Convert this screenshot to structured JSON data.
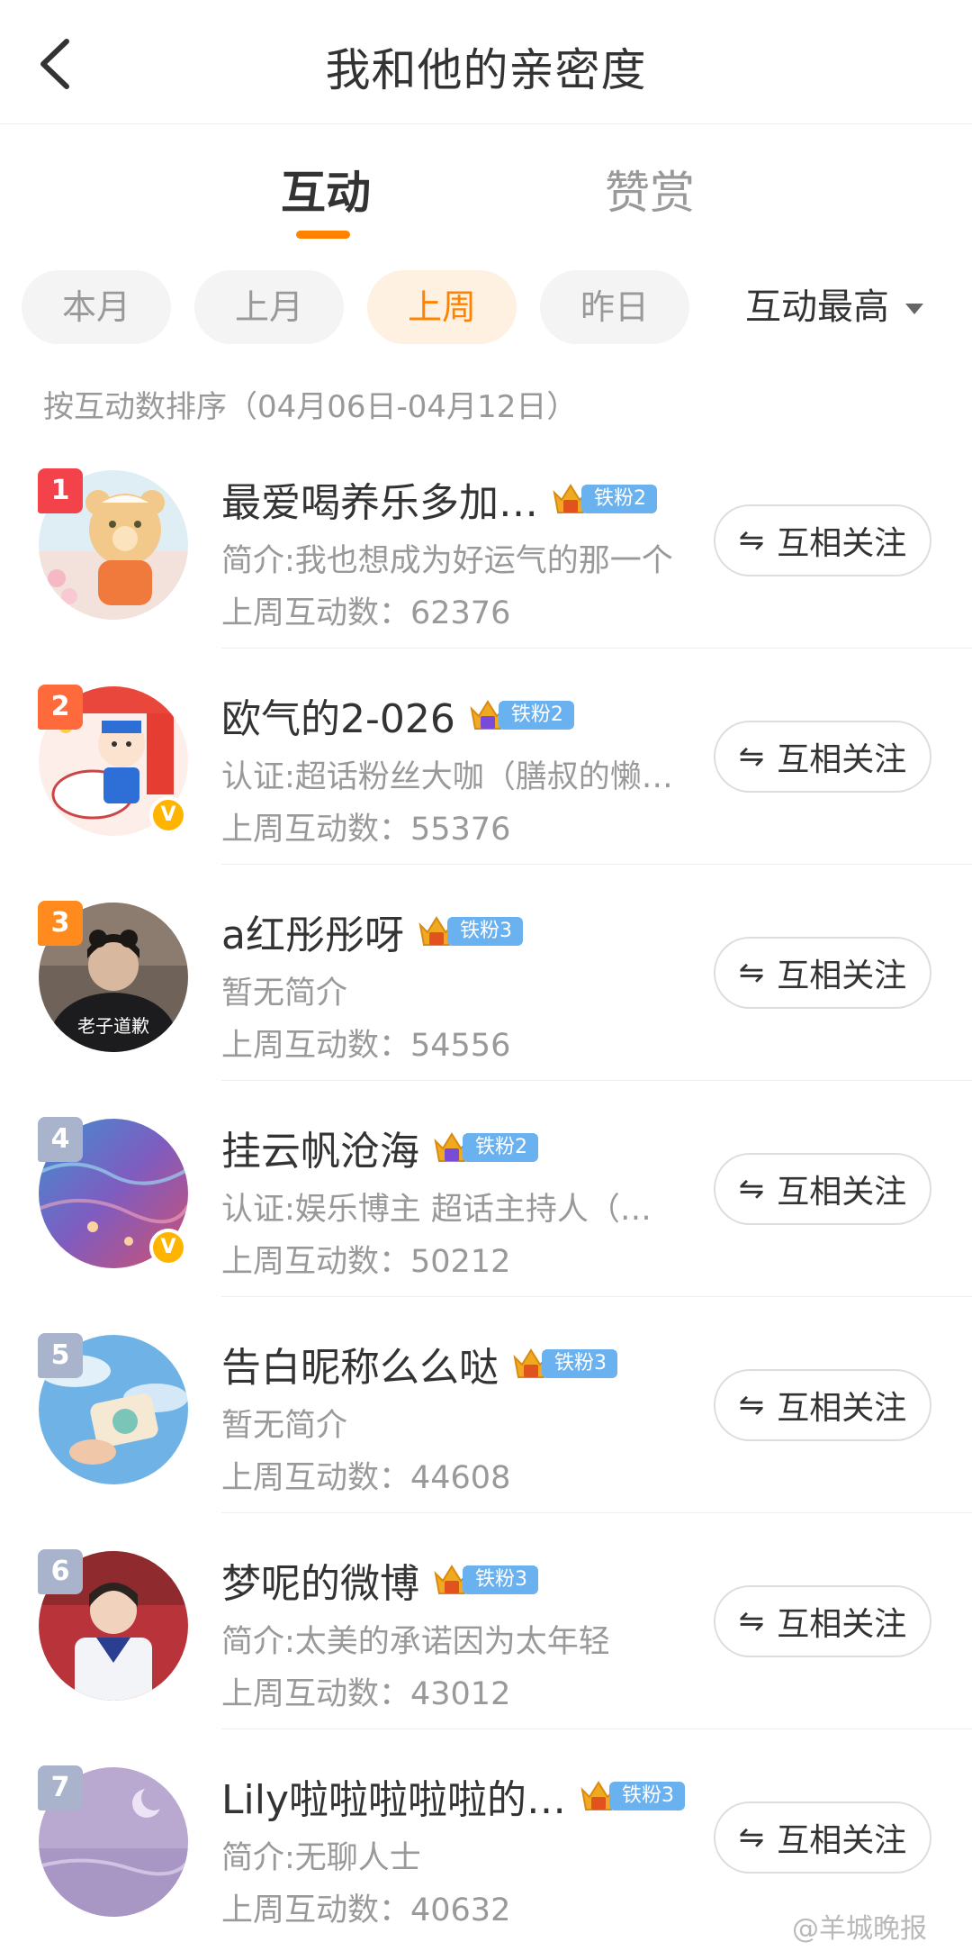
{
  "header": {
    "title": "我和他的亲密度"
  },
  "tabs": [
    {
      "label": "互动",
      "active": true
    },
    {
      "label": "赞赏",
      "active": false
    }
  ],
  "filters": [
    {
      "label": "本月",
      "active": false
    },
    {
      "label": "上月",
      "active": false
    },
    {
      "label": "上周",
      "active": true
    },
    {
      "label": "昨日",
      "active": false
    }
  ],
  "sort": {
    "label": "互动最高"
  },
  "sort_note": "按互动数排序（04月06日-04月12日）",
  "follow_label": "互相关注",
  "colors": {
    "accent": "#ff8200",
    "badge": "#6ab1f0",
    "rank1": "#f3424a",
    "rank2": "#ff6a3d",
    "rank3": "#ff8a1e",
    "rank_other": "#a9b3cc"
  },
  "rows": [
    {
      "rank": "1",
      "name": "最爱喝养乐多加…",
      "badge": "铁粉2",
      "desc": "简介:我也想成为好运气的那一个",
      "count": "上周互动数：62376",
      "verified": false
    },
    {
      "rank": "2",
      "name": "欧气的2-026",
      "badge": "铁粉2",
      "desc": "认证:超话粉丝大咖（膳叔的懒…",
      "count": "上周互动数：55376",
      "verified": true
    },
    {
      "rank": "3",
      "name": "a红彤彤呀",
      "badge": "铁粉3",
      "desc": "暂无简介",
      "count": "上周互动数：54556",
      "verified": false,
      "avatar_text": "老子道歉"
    },
    {
      "rank": "4",
      "name": "挂云帆沧海",
      "badge": "铁粉2",
      "desc": "认证:娱乐博主 超话主持人（…",
      "count": "上周互动数：50212",
      "verified": true
    },
    {
      "rank": "5",
      "name": "告白昵称么么哒",
      "badge": "铁粉3",
      "desc": "暂无简介",
      "count": "上周互动数：44608",
      "verified": false
    },
    {
      "rank": "6",
      "name": "梦呢的微博",
      "badge": "铁粉3",
      "desc": "简介:太美的承诺因为太年轻",
      "count": "上周互动数：43012",
      "verified": false
    },
    {
      "rank": "7",
      "name": "Lily啦啦啦啦啦的…",
      "badge": "铁粉3",
      "desc": "简介:无聊人士",
      "count": "上周互动数：40632",
      "verified": false
    }
  ],
  "watermark": "@羊城晚报"
}
